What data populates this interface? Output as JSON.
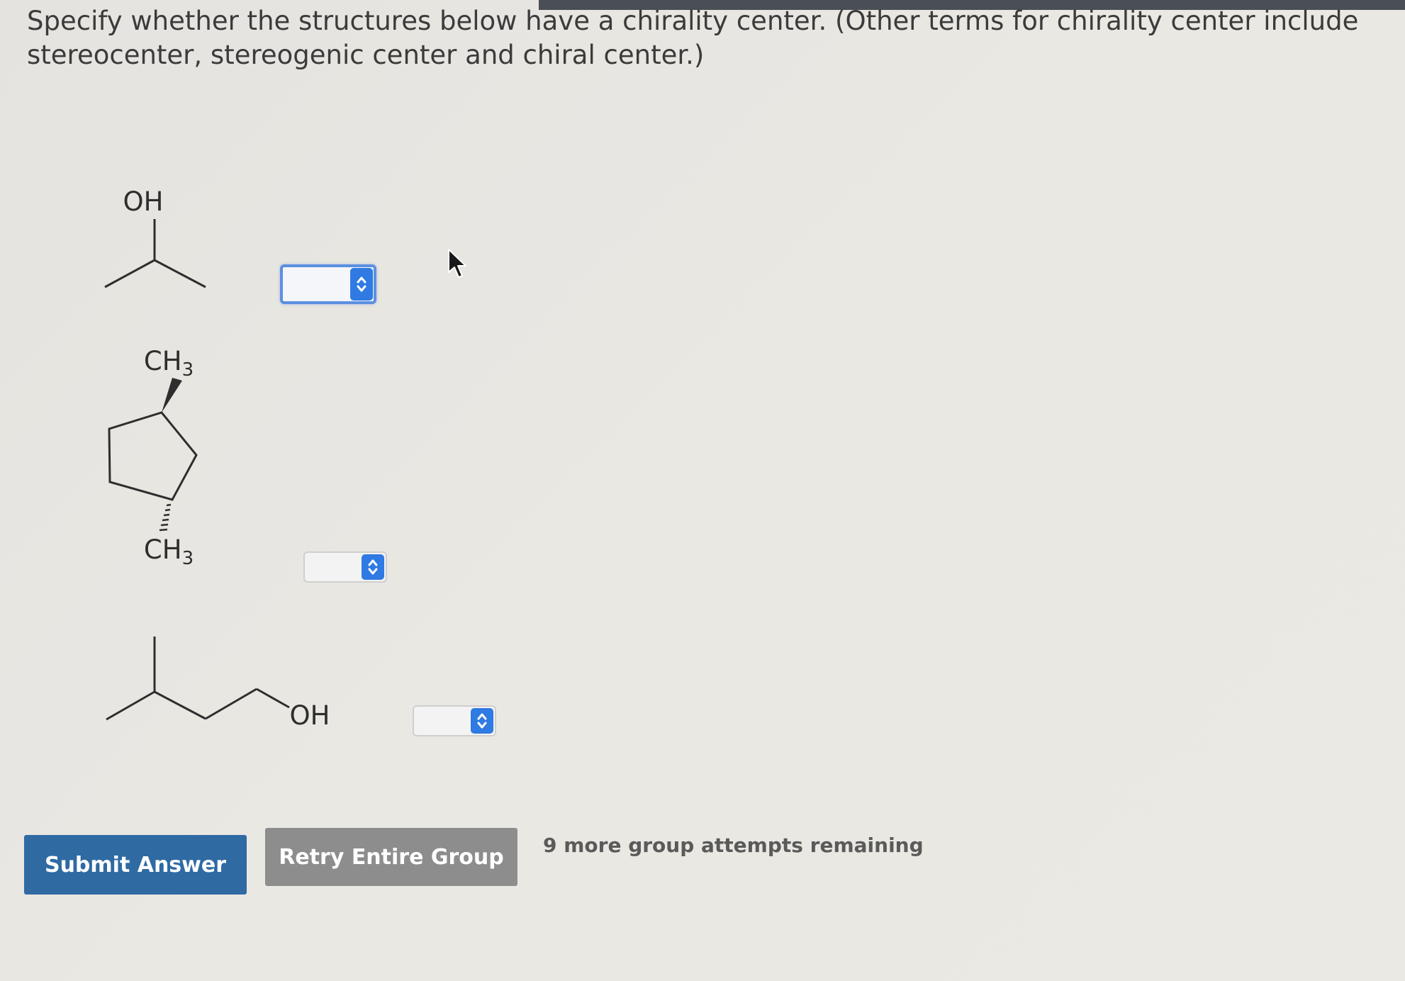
{
  "question": {
    "text": "Specify whether the structures below have a chirality center. (Other terms for chirality center include stereocenter, stereogenic center and chiral center.)"
  },
  "molecules": [
    {
      "labels": {
        "top": "OH"
      }
    },
    {
      "labels": {
        "top_main": "CH",
        "top_sub": "3",
        "bottom_main": "CH",
        "bottom_sub": "3"
      }
    },
    {
      "labels": {
        "oh": "OH"
      }
    }
  ],
  "answers": [
    {
      "selected": "",
      "icon": "updown-chevron-icon",
      "focused": true
    },
    {
      "selected": "",
      "icon": "updown-chevron-icon",
      "focused": false
    },
    {
      "selected": "",
      "icon": "updown-chevron-icon",
      "focused": false
    }
  ],
  "actions": {
    "submit_label": "Submit Answer",
    "retry_label": "Retry Entire Group",
    "attempts_text": "9 more group attempts remaining"
  },
  "colors": {
    "accent": "#2f7ae3",
    "submit": "#2f6aa3",
    "retry": "#8d8d8d"
  }
}
